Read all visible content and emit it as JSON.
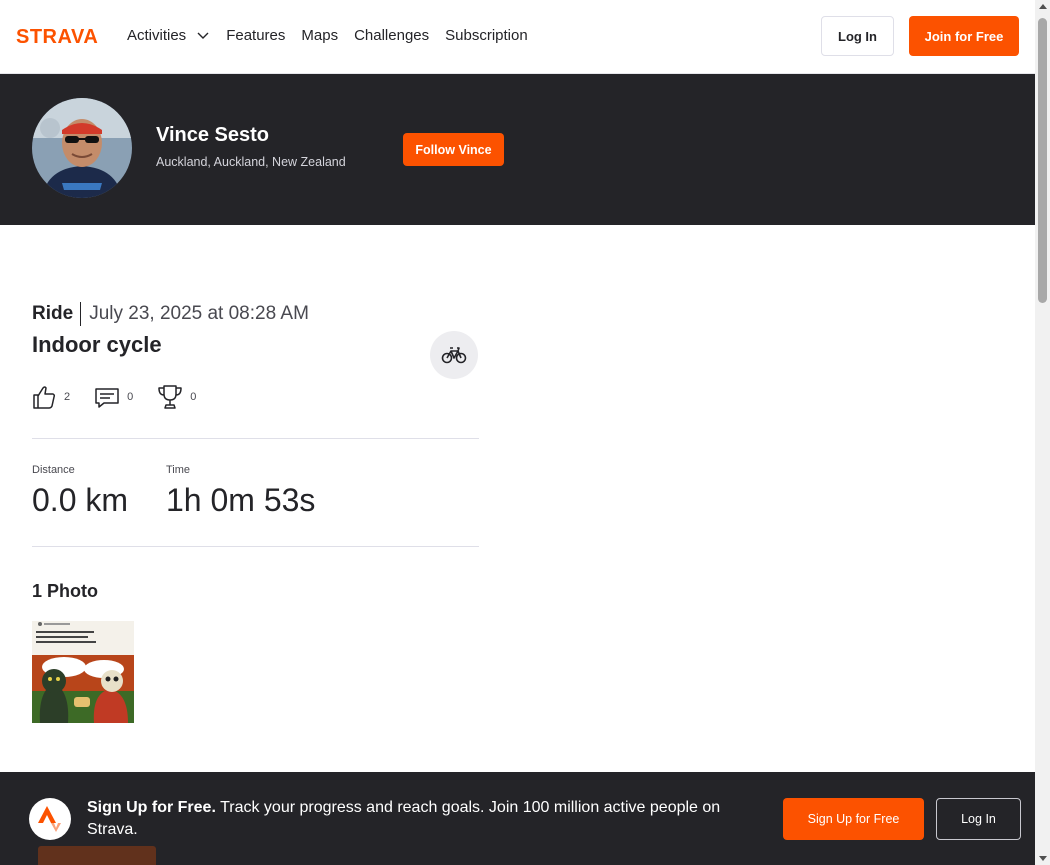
{
  "nav": {
    "logo_text": "STRAVA",
    "links": [
      "Activities",
      "Features",
      "Maps",
      "Challenges",
      "Subscription"
    ],
    "login_label": "Log In",
    "join_label": "Join for Free"
  },
  "athlete": {
    "name": "Vince Sesto",
    "location": "Auckland, Auckland, New Zealand",
    "follow_label": "Follow Vince"
  },
  "activity": {
    "type": "Ride",
    "date": "July 23, 2025 at 08:28 AM",
    "title": "Indoor cycle",
    "sport_icon": "bike-icon",
    "kudos": "2",
    "comments": "0",
    "achievements": "0",
    "stats": [
      {
        "label": "Distance",
        "value": "0.0 km"
      },
      {
        "label": "Time",
        "value": "1h 0m 53s"
      }
    ],
    "photos_title": "1 Photo"
  },
  "footer": {
    "headline": "Sign Up for Free.",
    "body": "Track your progress and reach goals. Join 100 million active people on Strava.",
    "signup_label": "Sign Up for Free",
    "login_label": "Log In"
  },
  "colors": {
    "brand": "#fc5200",
    "dark": "#242428"
  }
}
